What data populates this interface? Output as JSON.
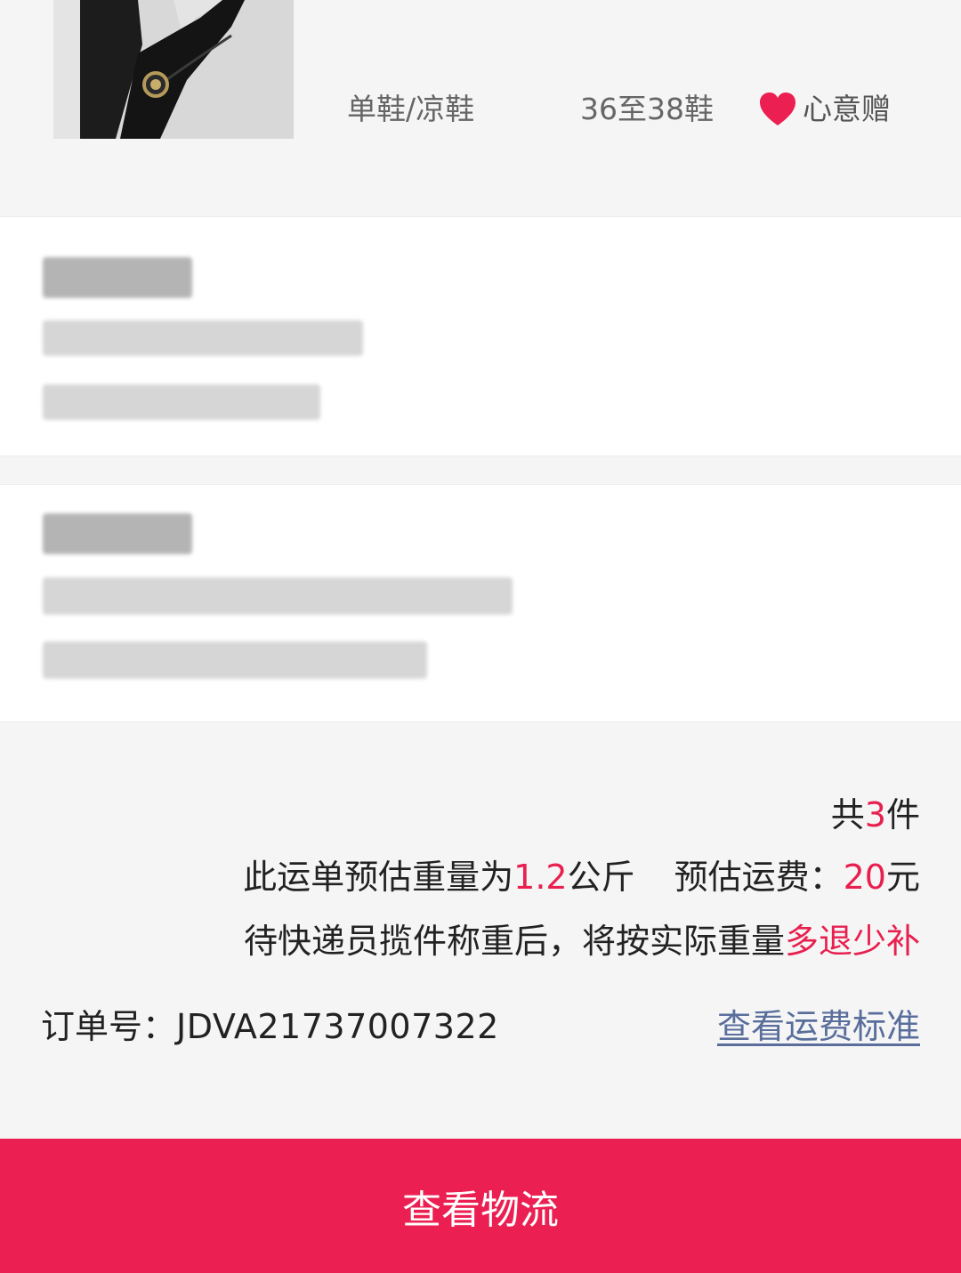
{
  "product": {
    "category": "单鞋/凉鞋",
    "size": "36至38鞋",
    "gift_label": "心意赠",
    "gift_icon": "heart-icon",
    "accent_color": "#eb1f51"
  },
  "summary": {
    "total_prefix": "共",
    "total_count": "3",
    "total_suffix": "件",
    "weight_prefix": "此运单预估重量为",
    "weight_value": "1.2",
    "weight_unit": "公斤",
    "fee_label": "预估运费：",
    "fee_value": "20",
    "fee_unit": "元",
    "notice_prefix": "待快递员揽件称重后，将按实际重量",
    "notice_highlight": "多退少补"
  },
  "order": {
    "label": "订单号：",
    "number": "JDVA21737007322",
    "fee_standard_link": "查看运费标准"
  },
  "bottom_button": {
    "label": "查看物流"
  }
}
